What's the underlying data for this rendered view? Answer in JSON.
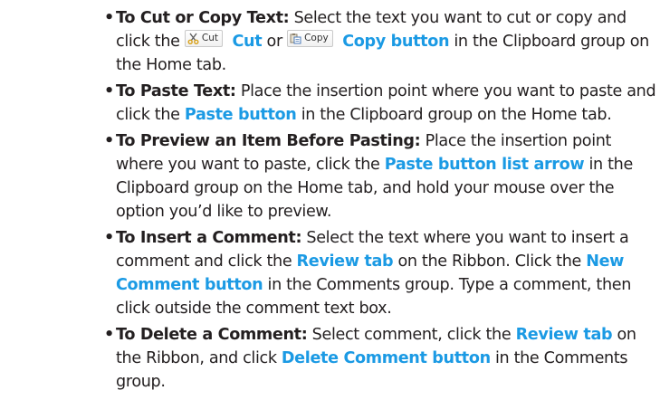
{
  "items": [
    {
      "lead": "To Cut or Copy Text:",
      "t1": " Select the text you want to cut or copy and click the ",
      "cut_btn_label": "Cut",
      "cut_link": "Cut",
      "or": " or ",
      "copy_btn_label": "Copy",
      "copy_link": "Copy button",
      "t2": " in the Clipboard group on the Home tab."
    },
    {
      "lead": "To Paste Text:",
      "t1": " Place the insertion point where you want to paste and click the ",
      "link1": "Paste button",
      "t2": " in the Clipboard group on the Home tab."
    },
    {
      "lead": "To Preview an Item Before Pasting:",
      "t1": " Place the insertion point where you want to paste, click the ",
      "link1": "Paste button list arrow",
      "t2": " in the Clipboard group on the Home tab, and hold your mouse over the option you’d like to preview."
    },
    {
      "lead": "To Insert a Comment:",
      "t1": " Select the text where you want to insert a comment and click the ",
      "link1": "Review tab",
      "t2": " on the Ribbon. Click the ",
      "link2": "New Comment button",
      "t3": " in the Comments group. Type a comment, then click outside the comment text box."
    },
    {
      "lead": "To Delete a Comment:",
      "t1": " Select comment, click the ",
      "link1": "Review tab",
      "t2": " on the Ribbon, and click ",
      "link2": "Delete Comment button",
      "t3": " in the Comments group."
    }
  ],
  "icons": {
    "cut": "scissors-icon",
    "copy": "clipboard-copy-icon"
  },
  "colors": {
    "highlight": "#1b9ae4",
    "text": "#231f20"
  }
}
